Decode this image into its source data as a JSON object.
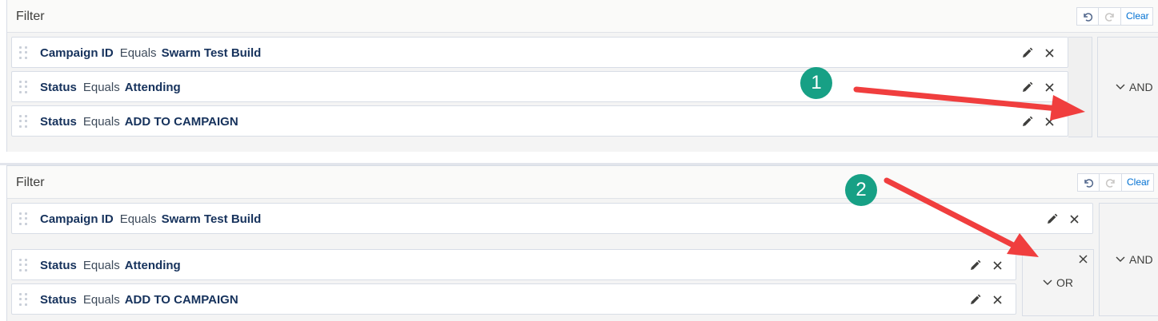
{
  "colors": {
    "accent_link": "#0070d2",
    "badge": "#17a085",
    "arrow": "#f03e3e",
    "text": "#16325c"
  },
  "icons": {
    "undo": "undo-icon",
    "redo": "redo-icon",
    "edit": "pencil-icon",
    "remove": "close-icon",
    "drag": "drag-handle-icon",
    "expand": "chevron-down-icon"
  },
  "top_panel": {
    "title": "Filter",
    "clear_label": "Clear",
    "rows": [
      {
        "field": "Campaign ID",
        "operator": "Equals",
        "value": "Swarm Test Build"
      },
      {
        "field": "Status",
        "operator": "Equals",
        "value": "Attending"
      },
      {
        "field": "Status",
        "operator": "Equals",
        "value": "ADD TO CAMPAIGN"
      }
    ],
    "logic_label": "AND",
    "step_badge": "1"
  },
  "bottom_panel": {
    "title": "Filter",
    "clear_label": "Clear",
    "rows": [
      {
        "field": "Campaign ID",
        "operator": "Equals",
        "value": "Swarm Test Build"
      },
      {
        "field": "Status",
        "operator": "Equals",
        "value": "Attending"
      },
      {
        "field": "Status",
        "operator": "Equals",
        "value": "ADD TO CAMPAIGN"
      }
    ],
    "group_logic_label": "OR",
    "logic_label": "AND",
    "step_badge": "2"
  }
}
